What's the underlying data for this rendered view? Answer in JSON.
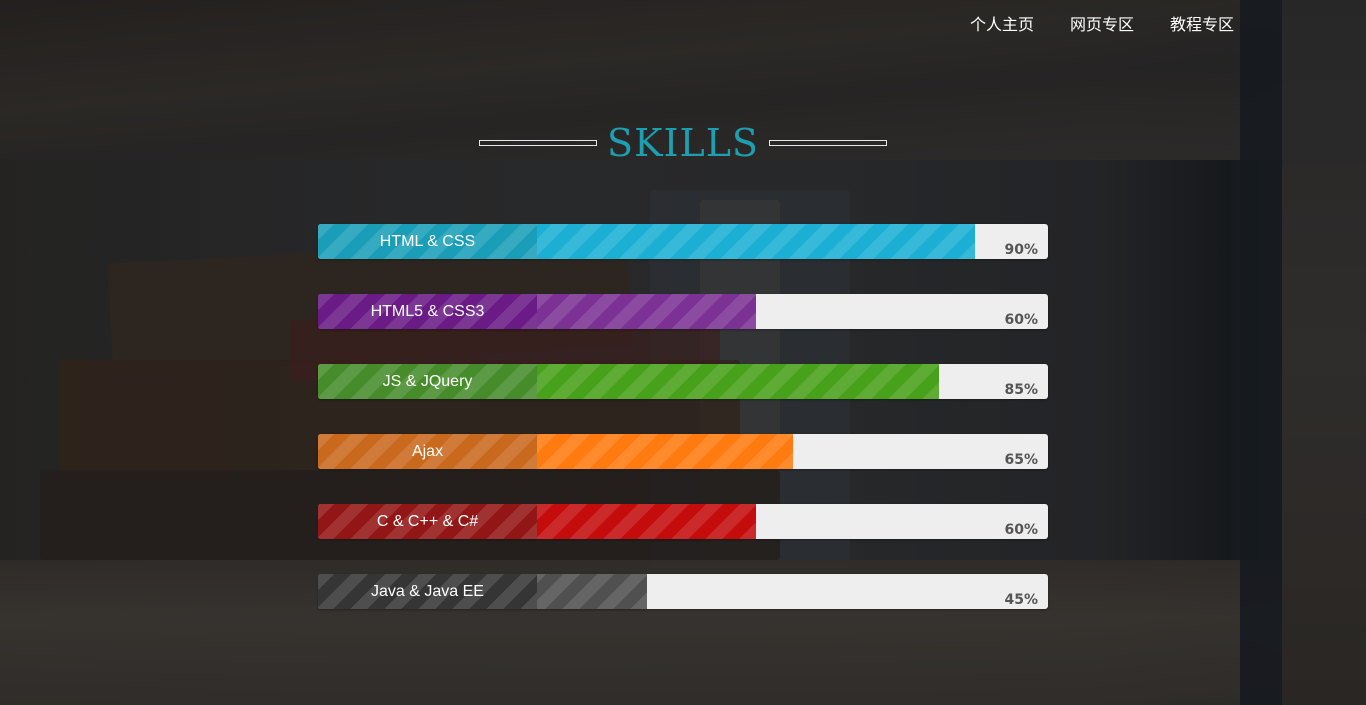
{
  "nav": {
    "items": [
      {
        "label": "个人主页"
      },
      {
        "label": "网页专区"
      },
      {
        "label": "教程专区"
      }
    ]
  },
  "section": {
    "title": "SKILLS"
  },
  "skills": [
    {
      "label": "HTML & CSS",
      "percent_text": "90%",
      "percent": 90,
      "fill_color": "#1bafd4",
      "label_color": "#1a9eb8"
    },
    {
      "label": "HTML5 & CSS3",
      "percent_text": "60%",
      "percent": 60,
      "fill_color": "#7b3294",
      "label_color": "#6a1b86"
    },
    {
      "label": "JS & JQuery",
      "percent_text": "85%",
      "percent": 85,
      "fill_color": "#48a11a",
      "label_color": "#478c2b"
    },
    {
      "label": "Ajax",
      "percent_text": "65%",
      "percent": 65,
      "fill_color": "#ff7b0f",
      "label_color": "#c9691e"
    },
    {
      "label": "C & C++ & C#",
      "percent_text": "60%",
      "percent": 60,
      "fill_color": "#c40c0c",
      "label_color": "#931616"
    },
    {
      "label": "Java & Java EE",
      "percent_text": "45%",
      "percent": 45,
      "fill_color": "#505050",
      "label_color": "#353535"
    }
  ]
}
